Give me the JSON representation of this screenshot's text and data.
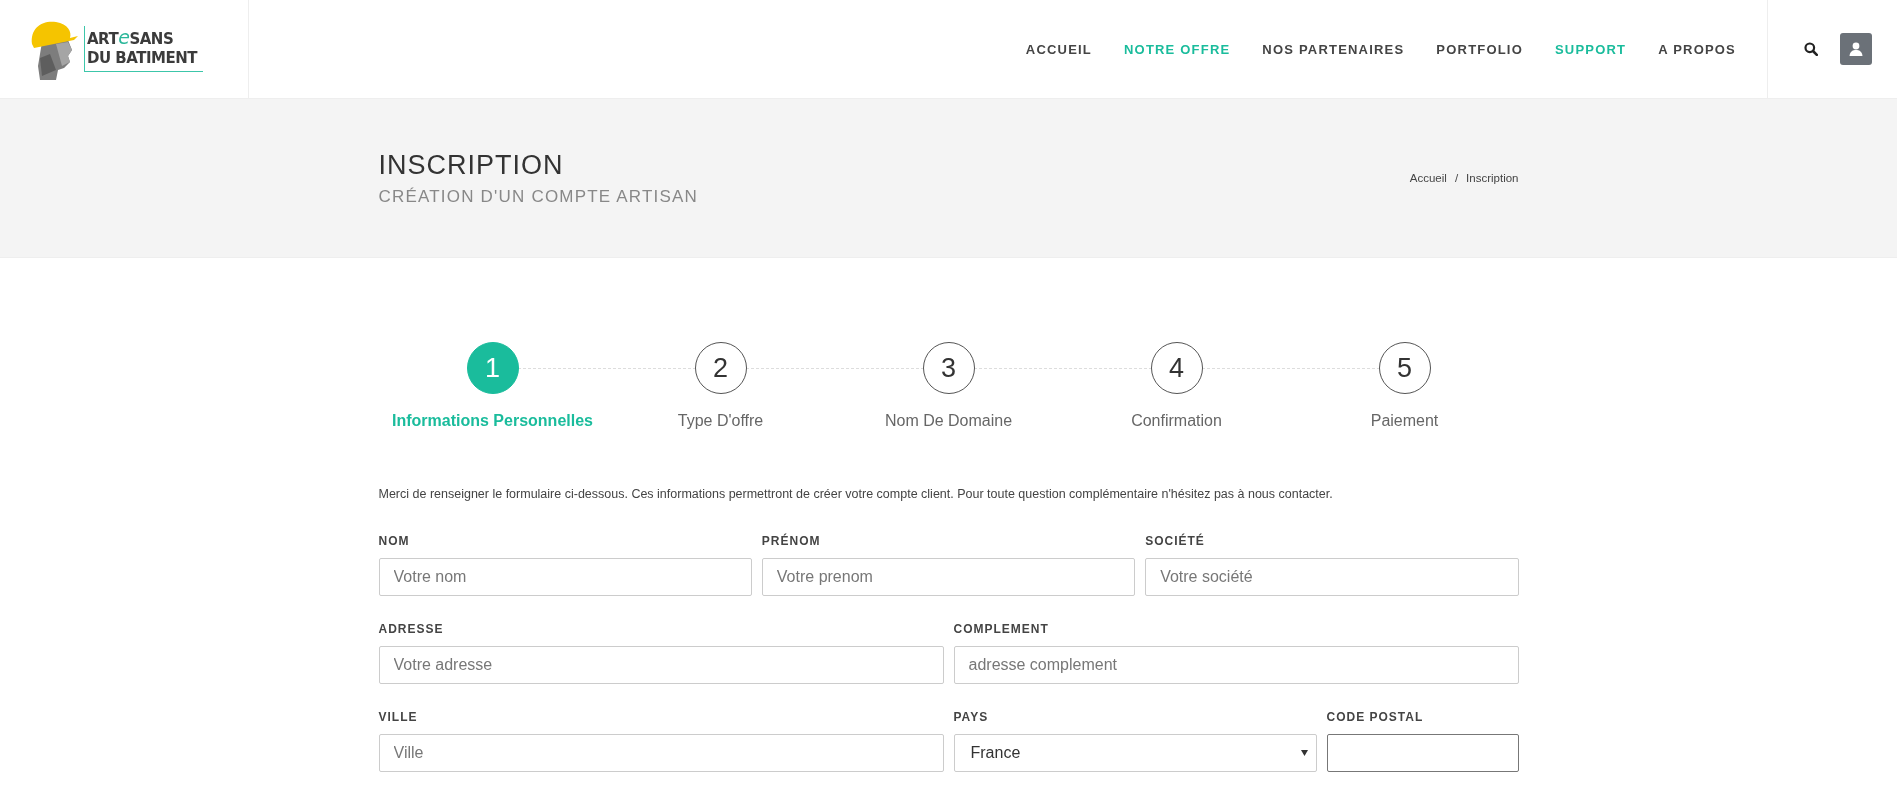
{
  "logo": {
    "word_start": "ART",
    "word_accent": "e",
    "word_end": "SANS",
    "line2": "DU BATIMENT"
  },
  "nav": [
    {
      "label": "ACCUEIL",
      "highlighted": false
    },
    {
      "label": "NOTRE OFFRE",
      "highlighted": true
    },
    {
      "label": "NOS PARTENAIRES",
      "highlighted": false
    },
    {
      "label": "PORTFOLIO",
      "highlighted": false
    },
    {
      "label": "SUPPORT",
      "highlighted": true
    },
    {
      "label": "A PROPOS",
      "highlighted": false
    }
  ],
  "page_header": {
    "title": "INSCRIPTION",
    "subtitle": "CRÉATION D'UN COMPTE ARTISAN",
    "breadcrumb": [
      "Accueil",
      "Inscription"
    ],
    "breadcrumb_separator": "/"
  },
  "steps": [
    {
      "number": "1",
      "label": "Informations Personnelles",
      "selected": true
    },
    {
      "number": "2",
      "label": "Type D'offre",
      "selected": false
    },
    {
      "number": "3",
      "label": "Nom De Domaine",
      "selected": false
    },
    {
      "number": "4",
      "label": "Confirmation",
      "selected": false
    },
    {
      "number": "5",
      "label": "Paiement",
      "selected": false
    }
  ],
  "intro": "Merci de renseigner le formulaire ci-dessous. Ces informations permettront de créer votre compte client. Pour toute question complémentaire n'hésitez pas à nous contacter.",
  "form_rows": [
    {
      "fields": [
        {
          "kind": "input",
          "label": "NOM",
          "placeholder": "Votre nom",
          "focused": false
        },
        {
          "kind": "input",
          "label": "PRÉNOM",
          "placeholder": "Votre prenom",
          "focused": false
        },
        {
          "kind": "input",
          "label": "SOCIÉTÉ",
          "placeholder": "Votre société",
          "focused": false
        }
      ]
    },
    {
      "fields": [
        {
          "kind": "input",
          "label": "ADRESSE",
          "placeholder": "Votre adresse",
          "focused": false
        },
        {
          "kind": "input",
          "label": "COMPLEMENT",
          "placeholder": "adresse complement",
          "focused": false
        }
      ]
    },
    {
      "fields": [
        {
          "kind": "input",
          "label": "VILLE",
          "placeholder": "Ville",
          "focused": false
        },
        {
          "kind": "select",
          "label": "PAYS",
          "value": "France",
          "focused": false
        },
        {
          "kind": "input",
          "label": "CODE POSTAL",
          "focused": true
        }
      ]
    }
  ]
}
